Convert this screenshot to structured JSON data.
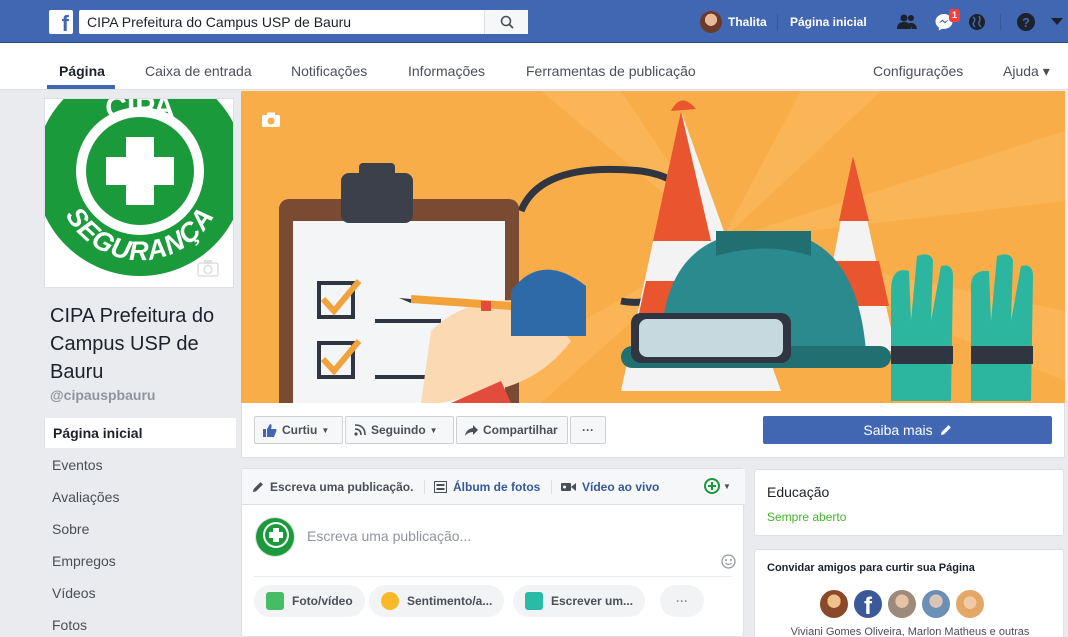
{
  "topbar": {
    "search_value": "CIPA Prefeitura do Campus USP de Bauru",
    "user_name": "Thalita",
    "home_label": "Página inicial",
    "messages_badge": "1"
  },
  "tabs": [
    {
      "label": "Página"
    },
    {
      "label": "Caixa de entrada"
    },
    {
      "label": "Notificações"
    },
    {
      "label": "Informações"
    },
    {
      "label": "Ferramentas de publicação"
    },
    {
      "label": "Configurações"
    },
    {
      "label": "Ajuda ▾"
    }
  ],
  "profile": {
    "logo_top": "CIPA",
    "logo_bottom": "SEGURANÇA",
    "name": "CIPA Prefeitura do Campus USP de Bauru",
    "handle": "@cipauspbauru"
  },
  "nav": [
    {
      "label": "Página inicial"
    },
    {
      "label": "Eventos"
    },
    {
      "label": "Avaliações"
    },
    {
      "label": "Sobre"
    },
    {
      "label": "Empregos"
    },
    {
      "label": "Vídeos"
    },
    {
      "label": "Fotos"
    }
  ],
  "actions": {
    "like": "Curtiu",
    "follow": "Seguindo",
    "share": "Compartilhar",
    "more": "···",
    "cta": "Saiba mais"
  },
  "composer": {
    "tab_write": "Escreva uma publicação.",
    "tab_album": "Álbum de fotos",
    "tab_live": "Vídeo ao vivo",
    "placeholder": "Escreva uma publicação...",
    "pill_photo": "Foto/vídeo",
    "pill_feeling": "Sentimento/a...",
    "pill_write": "Escrever um...",
    "pill_more": "···"
  },
  "about_card": {
    "category": "Educação",
    "hours": "Sempre aberto"
  },
  "invite_card": {
    "title": "Convidar amigos para curtir sua Página",
    "names": "Viviani Gomes Oliveira, Marlon Matheus e outras"
  },
  "colors": {
    "brand": "#4267b2",
    "cover_bg": "#f9ad48",
    "logo_green": "#1b9a3c",
    "open_green": "#42b72a"
  }
}
